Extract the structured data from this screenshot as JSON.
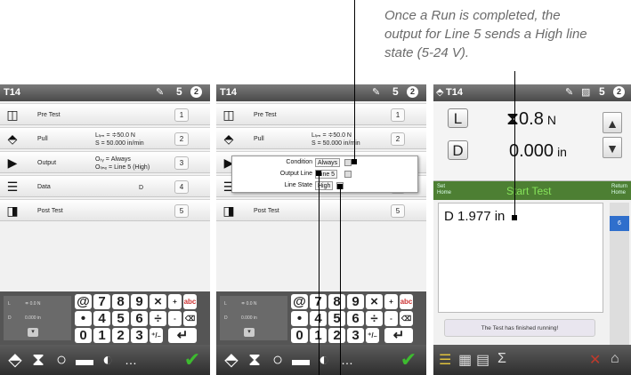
{
  "caption": {
    "line1": "Once a Run is completed, the",
    "line2": "output for Line 5 sends a High line",
    "line3": "state (5-24 V)."
  },
  "screens": {
    "title": "T14",
    "battery_value": "5",
    "badge": "2"
  },
  "steps": [
    {
      "icon": "pre-test-icon",
      "label": "Pre Test",
      "desc": "",
      "num": "1"
    },
    {
      "icon": "pull-icon",
      "label": "Pull",
      "desc1": "Lₗᵢₘ = ≑50.0 N",
      "desc2": "S = 50.000 in/min",
      "num": "2"
    },
    {
      "icon": "output-icon",
      "label": "Output",
      "desc1": "Oₜᵧ = Always",
      "desc2": "Oₗᵢₙₑ = Line 5 (High)",
      "num": "3"
    },
    {
      "icon": "data-icon",
      "label": "Data",
      "desc": "D",
      "num": "4"
    },
    {
      "icon": "post-test-icon",
      "label": "Post Test",
      "desc": "",
      "num": "5"
    }
  ],
  "keypad": {
    "left_l": "L",
    "left_l_val": "≑ 0.0 N",
    "left_d": "D",
    "left_d_val": "0.000 in",
    "row1": [
      "@",
      "7",
      "8",
      "9",
      "×",
      "+",
      "abc"
    ],
    "row2": [
      "•",
      "4",
      "5",
      "6",
      "÷",
      "-",
      "⌫"
    ],
    "row3": [
      "0",
      "1",
      "2",
      "3",
      "⁺/₋",
      "↵"
    ]
  },
  "popup": {
    "condition_label": "Condition",
    "condition_value": "Always",
    "output_line_label": "Output Line",
    "output_line_value": "Line 5",
    "line_state_label": "Line State",
    "line_state_value": "High"
  },
  "run_screen": {
    "l_button": "L",
    "d_button": "D",
    "load_value": "0.8",
    "load_unit": "N",
    "dist_value": "0.000",
    "dist_unit": "in",
    "set_home": "Set\nHome",
    "start_test": "Start Test",
    "return_home": "Return\nHome",
    "result": "D 1.977 in",
    "side_tab": "6",
    "status_message": "The Test has finished running!",
    "sigma": "Σ"
  }
}
